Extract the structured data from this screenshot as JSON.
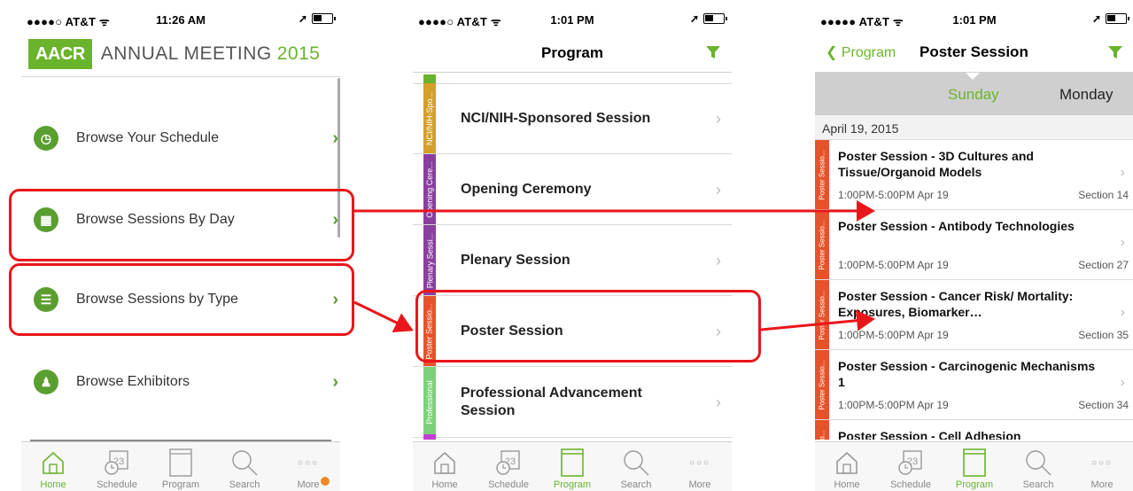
{
  "colors": {
    "accent_green": "#6ab42d",
    "highlight_red": "#e8161b",
    "poster_orange": "#e8522a"
  },
  "phone1": {
    "status": {
      "carrier": "●●●●○ AT&T ᯤ",
      "time": "11:26 AM"
    },
    "header": {
      "logo": "AACR",
      "title": "ANNUAL MEETING",
      "year": "2015"
    },
    "menu": [
      {
        "label": "Browse Your Schedule",
        "icon": "calendar-clock-icon"
      },
      {
        "label": "Browse Sessions By Day",
        "icon": "calendar-day-icon"
      },
      {
        "label": "Browse Sessions by Type",
        "icon": "list-icon"
      },
      {
        "label": "Browse Exhibitors",
        "icon": "exhibitor-icon"
      }
    ]
  },
  "phone2": {
    "status": {
      "carrier": "●●●●○ AT&T ᯤ",
      "time": "1:01 PM"
    },
    "nav_title": "Program",
    "rows": [
      {
        "label": "NCI/NIH-Sponsored Session",
        "tag": "NCI/NIH-Spo...",
        "tag_color": "#d4a02a"
      },
      {
        "label": "Opening Ceremony",
        "tag": "Opening Cere...",
        "tag_color": "#8a3fa0"
      },
      {
        "label": "Plenary Session",
        "tag": "Plenary Sessi...",
        "tag_color": "#8a3fa0"
      },
      {
        "label": "Poster Session",
        "tag": "Poster Sessio...",
        "tag_color": "#e8522a"
      },
      {
        "label": "Professional Advancement Session",
        "tag": "Professional",
        "tag_color": "#7cd27a"
      }
    ]
  },
  "phone3": {
    "status": {
      "carrier": "●●●●● AT&T ᯤ",
      "time": "1:01 PM"
    },
    "back_label": "Program",
    "nav_title": "Poster Session",
    "days": {
      "active": "Sunday",
      "next": "Monday"
    },
    "date": "April 19, 2015",
    "sessions": [
      {
        "title": "Poster Session - 3D Cultures and Tissue/Organoid Models",
        "time": "1:00PM-5:00PM  Apr 19",
        "section": "Section 14",
        "tag": "Poster Sessio..."
      },
      {
        "title": "Poster Session - Antibody Technologies",
        "time": "1:00PM-5:00PM  Apr 19",
        "section": "Section 27",
        "tag": "Poster Sessio..."
      },
      {
        "title": "Poster Session - Cancer Risk/ Mortality: Exposures, Biomarker…",
        "time": "1:00PM-5:00PM  Apr 19",
        "section": "Section 35",
        "tag": "Poster Sessio..."
      },
      {
        "title": "Poster Session - Carcinogenic Mechanisms 1",
        "time": "1:00PM-5:00PM  Apr 19",
        "section": "Section 34",
        "tag": "Poster Sessio..."
      },
      {
        "title": "Poster Session - Cell Adhesion",
        "time": "",
        "section": "",
        "tag": "Poster Sessio..."
      }
    ]
  },
  "tabbar": {
    "tabs": [
      {
        "label": "Home",
        "icon": "home-icon"
      },
      {
        "label": "Schedule",
        "icon": "schedule-icon"
      },
      {
        "label": "Program",
        "icon": "program-book-icon"
      },
      {
        "label": "Search",
        "icon": "search-icon"
      },
      {
        "label": "More",
        "icon": "more-icon"
      }
    ],
    "schedule_day": "23"
  }
}
